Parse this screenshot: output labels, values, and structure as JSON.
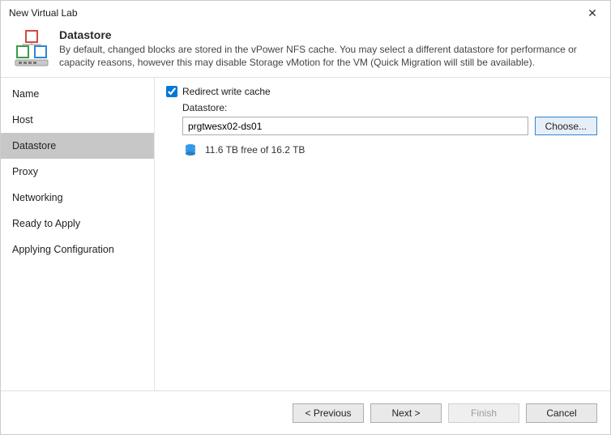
{
  "window": {
    "title": "New Virtual Lab"
  },
  "header": {
    "heading": "Datastore",
    "description": "By default, changed blocks are stored in the vPower NFS cache. You may select a different datastore for performance or capacity reasons, however this may disable Storage vMotion for the VM (Quick Migration will still be available)."
  },
  "sidebar": {
    "items": [
      {
        "label": "Name"
      },
      {
        "label": "Host"
      },
      {
        "label": "Datastore"
      },
      {
        "label": "Proxy"
      },
      {
        "label": "Networking"
      },
      {
        "label": "Ready to Apply"
      },
      {
        "label": "Applying Configuration"
      }
    ],
    "active_index": 2
  },
  "content": {
    "redirect_label": "Redirect write cache",
    "redirect_checked": true,
    "datastore_label": "Datastore:",
    "datastore_value": "prgtwesx02-ds01",
    "choose_label": "Choose...",
    "free_space": "11.6 TB free of 16.2 TB"
  },
  "footer": {
    "previous": "< Previous",
    "next": "Next >",
    "finish": "Finish",
    "cancel": "Cancel"
  },
  "colors": {
    "accent": "#2f86d4",
    "icon_blue": "#3399e6"
  }
}
